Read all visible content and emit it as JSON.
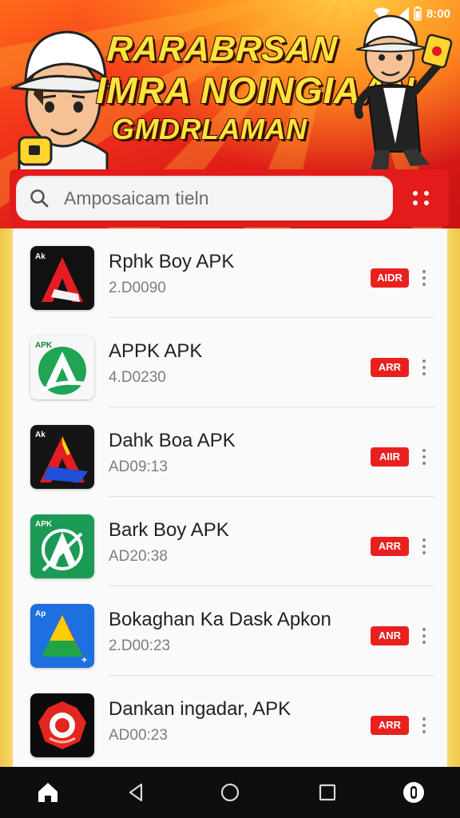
{
  "status_bar": {
    "time": "8:00"
  },
  "banner": {
    "line1": "RARABRSAN",
    "line2": "IMRA NOINGIAAN",
    "line3": "GMDRLAMAN"
  },
  "search": {
    "placeholder": "Amposaicam tieln"
  },
  "apps": [
    {
      "name": "Rphk Boy APK",
      "sub": "2.D0090",
      "badge": "AIDR",
      "icon": "red-triangle-app-icon",
      "icon_label": "Ak"
    },
    {
      "name": "APPK APK",
      "sub": "4.D0230",
      "badge": "ARR",
      "icon": "green-triangle-app-icon",
      "icon_label": "APK"
    },
    {
      "name": "Dahk Boa APK",
      "sub": "AD09:13",
      "badge": "AIIR",
      "icon": "red-blue-triangle-app-icon",
      "icon_label": "Ak"
    },
    {
      "name": "Bark Boy APK",
      "sub": "AD20:38",
      "badge": "ARR",
      "icon": "green-a-app-icon",
      "icon_label": "APK"
    },
    {
      "name": "Bokaghan Ka Dask Apkon",
      "sub": "2.D00:23",
      "badge": "ANR",
      "icon": "drive-triangle-app-icon",
      "icon_label": "Ap"
    },
    {
      "name": "Dankan ingadar, APK",
      "sub": "AD00:23",
      "badge": "ARR",
      "icon": "red-badge-app-icon",
      "icon_label": ""
    }
  ],
  "colors": {
    "accent": "#e31b1b",
    "badge": "#e8211e",
    "headline": "#ffe43a",
    "nav": "#0e0e0e"
  },
  "nav": {
    "items": [
      "home-icon",
      "back-icon",
      "home-circle-icon",
      "recents-icon",
      "assistant-icon"
    ]
  }
}
